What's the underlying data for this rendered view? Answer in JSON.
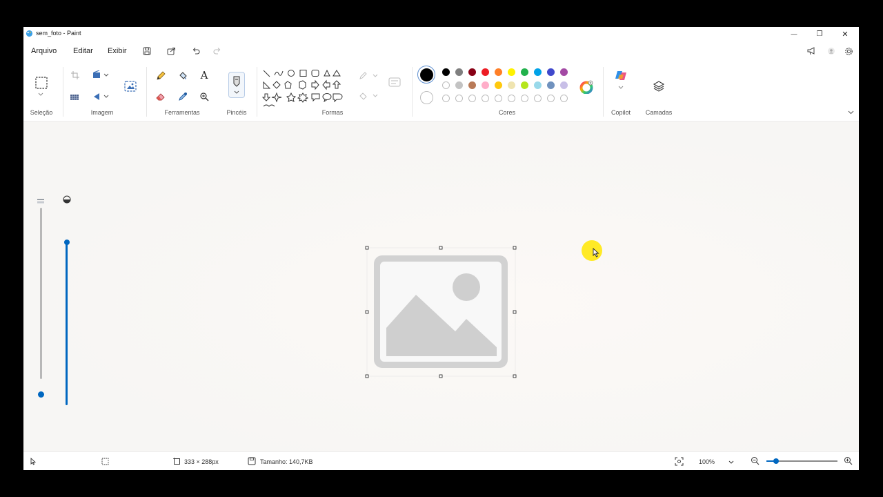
{
  "window": {
    "title": "sem_foto - Paint",
    "controls": {
      "minimize": "—",
      "maximize": "❐",
      "close": "✕"
    }
  },
  "menu": {
    "file": "Arquivo",
    "edit": "Editar",
    "view": "Exibir"
  },
  "ribbon": {
    "groups": {
      "selection": "Seleção",
      "image": "Imagem",
      "tools": "Ferramentas",
      "brushes": "Pincéis",
      "shapes": "Formas",
      "colors": "Cores",
      "copilot": "Copilot",
      "layers": "Camadas"
    },
    "text_tool_glyph": "A",
    "primary_color": "#000000",
    "palette_row1": [
      "#000000",
      "#7f7f7f",
      "#880015",
      "#ed1c24",
      "#ff7f27",
      "#fff200",
      "#22b14c",
      "#00a2e8",
      "#3f48cc",
      "#a349a4"
    ],
    "palette_row2": [
      "#ffffff",
      "#c3c3c3",
      "#b97a57",
      "#ffaec9",
      "#ffc90e",
      "#efe4b0",
      "#b5e61d",
      "#99d9ea",
      "#7092be",
      "#c8bfe7"
    ],
    "accent": "#0067c0"
  },
  "status": {
    "selection_size": "333 × 288px",
    "file_size": "Tamanho: 140,7KB",
    "zoom": "100%"
  }
}
